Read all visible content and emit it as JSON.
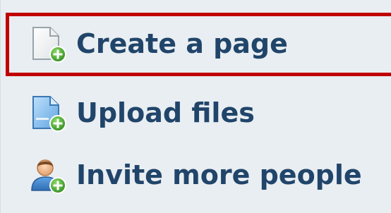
{
  "menu": {
    "items": [
      {
        "label": "Create a page",
        "icon": "new-page-plus-icon",
        "selected": true
      },
      {
        "label": "Upload files",
        "icon": "upload-file-plus-icon",
        "selected": false
      },
      {
        "label": "Invite more people",
        "icon": "invite-person-plus-icon",
        "selected": false
      }
    ],
    "colors": {
      "background": "#e9eef2",
      "label": "#21456a",
      "selection_border": "#c00000",
      "plus_badge": "#3a9a2a"
    }
  }
}
